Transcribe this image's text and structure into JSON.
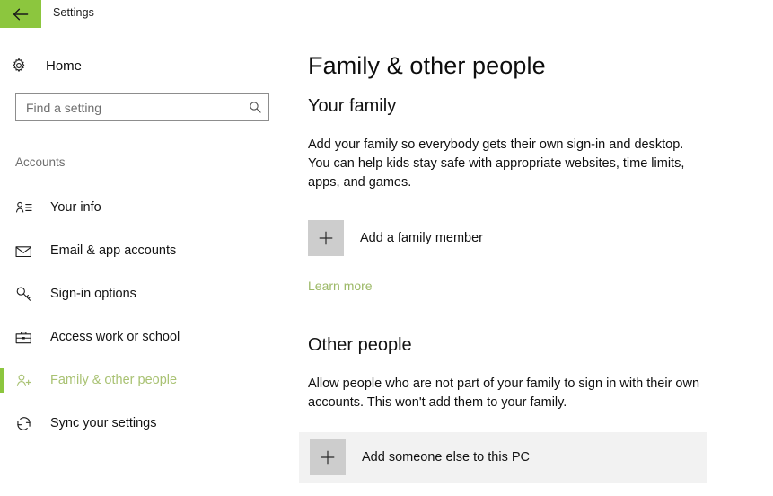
{
  "window": {
    "title": "Settings",
    "back_icon": "back-arrow-icon"
  },
  "sidebar": {
    "home": {
      "label": "Home",
      "icon": "gear-icon"
    },
    "search": {
      "value": "",
      "placeholder": "Find a setting",
      "icon": "search-icon"
    },
    "group_label": "Accounts",
    "items": [
      {
        "label": "Your info",
        "icon": "contact-card-icon",
        "selected": false
      },
      {
        "label": "Email & app accounts",
        "icon": "envelope-icon",
        "selected": false
      },
      {
        "label": "Sign-in options",
        "icon": "key-icon",
        "selected": false
      },
      {
        "label": "Access work or school",
        "icon": "briefcase-icon",
        "selected": false
      },
      {
        "label": "Family & other people",
        "icon": "person-plus-icon",
        "selected": true
      },
      {
        "label": "Sync your settings",
        "icon": "sync-icon",
        "selected": false
      }
    ]
  },
  "main": {
    "page_title": "Family & other people",
    "your_family": {
      "heading": "Your family",
      "description": "Add your family so everybody gets their own sign-in and desktop. You can help kids stay safe with appropriate websites, time limits, apps, and games.",
      "add_button_label": "Add a family member",
      "add_button_icon": "plus-icon",
      "learn_more_label": "Learn more"
    },
    "other_people": {
      "heading": "Other people",
      "description": "Allow people who are not part of your family to sign in with their own accounts. This won't add them to your family.",
      "add_button_label": "Add someone else to this PC",
      "add_button_icon": "plus-icon"
    }
  },
  "colors": {
    "accent_green": "#8cc63e",
    "selected_text": "#a9c273",
    "link_green": "#9cb967",
    "tile_gray": "#cdcdcd",
    "hover_row": "#f2f2f2"
  }
}
